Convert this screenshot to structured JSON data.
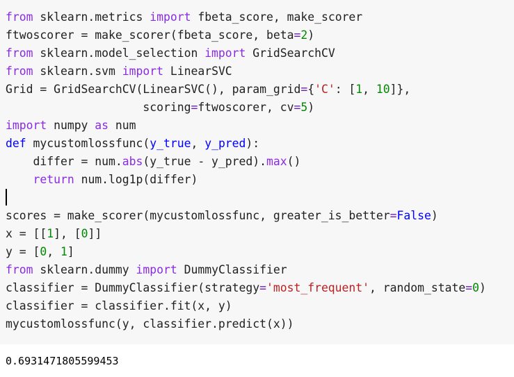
{
  "cell": {
    "lines": [
      [
        {
          "t": "from",
          "c": "kw"
        },
        {
          "t": " sklearn.metrics ",
          "c": "id"
        },
        {
          "t": "import",
          "c": "kw"
        },
        {
          "t": " fbeta_score, make_scorer",
          "c": "id"
        }
      ],
      [
        {
          "t": "ftwoscorer = make_scorer(fbeta_score, beta",
          "c": "id"
        },
        {
          "t": "=",
          "c": "op"
        },
        {
          "t": "2",
          "c": "num"
        },
        {
          "t": ")",
          "c": "id"
        }
      ],
      [
        {
          "t": "from",
          "c": "kw"
        },
        {
          "t": " sklearn.model_selection ",
          "c": "id"
        },
        {
          "t": "import",
          "c": "kw"
        },
        {
          "t": " GridSearchCV",
          "c": "id"
        }
      ],
      [
        {
          "t": "from",
          "c": "kw"
        },
        {
          "t": " sklearn.svm ",
          "c": "id"
        },
        {
          "t": "import",
          "c": "kw"
        },
        {
          "t": " LinearSVC",
          "c": "id"
        }
      ],
      [
        {
          "t": "Grid = GridSearchCV(LinearSVC(), param_grid",
          "c": "id"
        },
        {
          "t": "=",
          "c": "op"
        },
        {
          "t": "{",
          "c": "id"
        },
        {
          "t": "'C'",
          "c": "str"
        },
        {
          "t": ": [",
          "c": "id"
        },
        {
          "t": "1",
          "c": "num"
        },
        {
          "t": ", ",
          "c": "id"
        },
        {
          "t": "10",
          "c": "num"
        },
        {
          "t": "]},",
          "c": "id"
        }
      ],
      [
        {
          "t": "                    scoring",
          "c": "id"
        },
        {
          "t": "=",
          "c": "op"
        },
        {
          "t": "ftwoscorer, cv",
          "c": "id"
        },
        {
          "t": "=",
          "c": "op"
        },
        {
          "t": "5",
          "c": "num"
        },
        {
          "t": ")",
          "c": "id"
        }
      ],
      [
        {
          "t": "import",
          "c": "kw"
        },
        {
          "t": " numpy ",
          "c": "id"
        },
        {
          "t": "as",
          "c": "kw"
        },
        {
          "t": " num",
          "c": "id"
        }
      ],
      [
        {
          "t": "def",
          "c": "kw2"
        },
        {
          "t": " mycustomlossfunc(",
          "c": "id"
        },
        {
          "t": "y_true",
          "c": "fn"
        },
        {
          "t": ", ",
          "c": "id"
        },
        {
          "t": "y_pred",
          "c": "fn"
        },
        {
          "t": "):",
          "c": "id"
        }
      ],
      [
        {
          "t": "    differ = num.",
          "c": "id"
        },
        {
          "t": "abs",
          "c": "kw"
        },
        {
          "t": "(y_true - y_pred).",
          "c": "id"
        },
        {
          "t": "max",
          "c": "kw"
        },
        {
          "t": "()",
          "c": "id"
        }
      ],
      [
        {
          "t": "    ",
          "c": "id"
        },
        {
          "t": "return",
          "c": "kw"
        },
        {
          "t": " num.log1p(differ)",
          "c": "id"
        }
      ],
      [
        {
          "t": "",
          "c": "cursor"
        }
      ],
      [
        {
          "t": "scores = make_scorer(mycustomlossfunc, greater_is_better",
          "c": "id"
        },
        {
          "t": "=",
          "c": "op"
        },
        {
          "t": "False",
          "c": "kw2"
        },
        {
          "t": ")",
          "c": "id"
        }
      ],
      [
        {
          "t": "x = [[",
          "c": "id"
        },
        {
          "t": "1",
          "c": "num"
        },
        {
          "t": "], [",
          "c": "id"
        },
        {
          "t": "0",
          "c": "num"
        },
        {
          "t": "]]",
          "c": "id"
        }
      ],
      [
        {
          "t": "y = [",
          "c": "id"
        },
        {
          "t": "0",
          "c": "num"
        },
        {
          "t": ", ",
          "c": "id"
        },
        {
          "t": "1",
          "c": "num"
        },
        {
          "t": "]",
          "c": "id"
        }
      ],
      [
        {
          "t": "from",
          "c": "kw"
        },
        {
          "t": " sklearn.dummy ",
          "c": "id"
        },
        {
          "t": "import",
          "c": "kw"
        },
        {
          "t": " DummyClassifier",
          "c": "id"
        }
      ],
      [
        {
          "t": "classifier = DummyClassifier(strategy",
          "c": "id"
        },
        {
          "t": "=",
          "c": "op"
        },
        {
          "t": "'most_frequent'",
          "c": "str"
        },
        {
          "t": ", random_state",
          "c": "id"
        },
        {
          "t": "=",
          "c": "op"
        },
        {
          "t": "0",
          "c": "num"
        },
        {
          "t": ")",
          "c": "id"
        }
      ],
      [
        {
          "t": "classifier = classifier.fit(x, y)",
          "c": "id"
        }
      ],
      [
        {
          "t": "mycustomlossfunc(y, classifier.predict(x))",
          "c": "id"
        }
      ]
    ]
  },
  "output": {
    "text": "0.6931471805599453"
  },
  "colors": {
    "cell_background": "#f7f7f7",
    "keyword": "#8a2be2",
    "builtin_keyword": "#0000ff",
    "number": "#008800",
    "string": "#ba2121"
  }
}
